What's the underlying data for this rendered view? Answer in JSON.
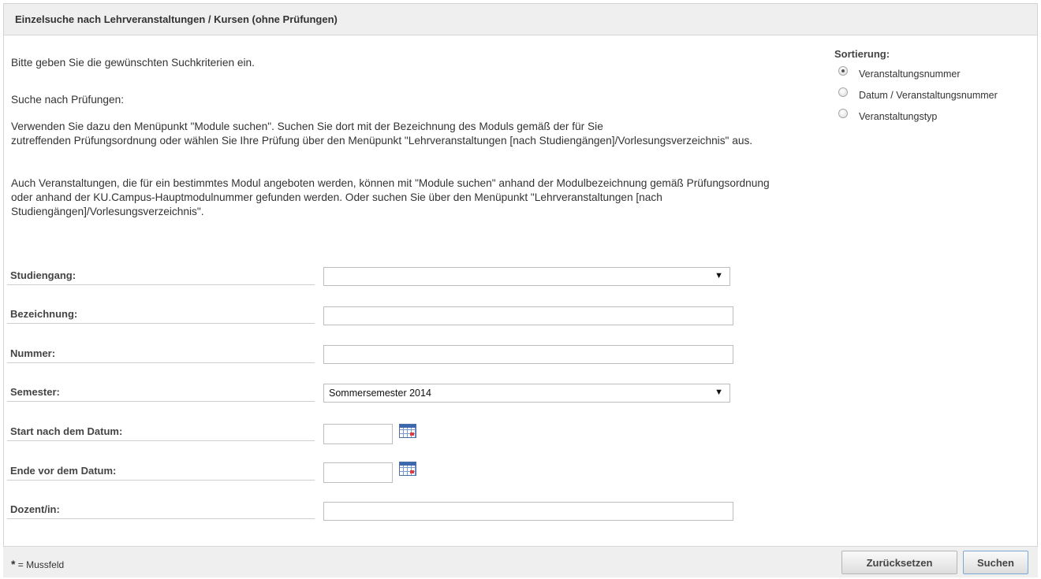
{
  "header": {
    "title": "Einzelsuche nach Lehrveranstaltungen / Kursen (ohne Prüfungen)"
  },
  "intro": {
    "line1": "Bitte geben Sie die gewünschten Suchkriterien ein.",
    "line2": "Suche nach Prüfungen:",
    "para1_line1": "Verwenden Sie dazu den Menüpunkt \"Module suchen\". Suchen Sie dort mit der Bezeichnung des Moduls gemäß der für Sie",
    "para1_line2": "zutreffenden Prüfungsordnung oder wählen Sie Ihre Prüfung über den Menüpunkt \"Lehrveranstaltungen [nach Studiengängen]/Vorlesungsverzeichnis\" aus.",
    "para2_line1": "Auch Veranstaltungen, die für ein bestimmtes Modul angeboten werden, können mit \"Module suchen\" anhand der Modulbezeichnung gemäß Prüfungsordnung",
    "para2_line2": "oder anhand der KU.Campus-Hauptmodulnummer gefunden werden. Oder suchen Sie über den Menüpunkt \"Lehrveranstaltungen [nach",
    "para2_line3": "Studiengängen]/Vorlesungsverzeichnis\"."
  },
  "sort": {
    "title": "Sortierung:",
    "options": [
      {
        "label": "Veranstaltungsnummer",
        "checked": true
      },
      {
        "label": "Datum / Veranstaltungsnummer",
        "checked": false
      },
      {
        "label": "Veranstaltungstyp",
        "checked": false
      }
    ]
  },
  "form": {
    "studiengang": {
      "label": "Studiengang:",
      "value": ""
    },
    "bezeichnung": {
      "label": "Bezeichnung:",
      "value": ""
    },
    "nummer": {
      "label": "Nummer:",
      "value": ""
    },
    "semester": {
      "label": "Semester:",
      "value": "Sommersemester 2014"
    },
    "start": {
      "label": "Start nach dem Datum:",
      "value": ""
    },
    "ende": {
      "label": "Ende vor dem Datum:",
      "value": ""
    },
    "dozent": {
      "label": "Dozent/in:",
      "value": ""
    },
    "dropdown_arrow": "▼",
    "calendar_icon": "calendar-icon"
  },
  "footer": {
    "star": "*",
    "note": "= Mussfeld",
    "reset_label": "Zurücksetzen",
    "search_label": "Suchen"
  }
}
